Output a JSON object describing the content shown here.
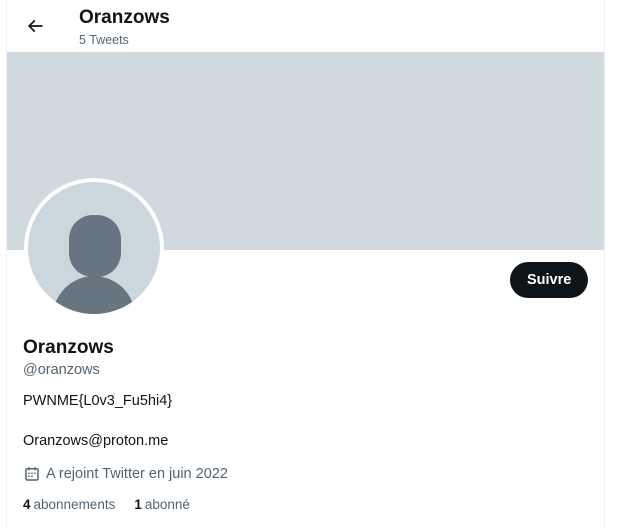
{
  "header": {
    "title": "Oranzows",
    "tweet_count": "5 Tweets",
    "back_icon": "arrow-left-icon"
  },
  "profile": {
    "banner_color": "#cfd9de",
    "avatar_icon": "default-avatar-icon",
    "follow_label": "Suivre",
    "name": "Oranzows",
    "handle": "@oranzows",
    "bio": "PWNME{L0v3_Fu5hi4}",
    "email": "Oranzows@proton.me",
    "joined_icon": "calendar-icon",
    "joined": "A rejoint Twitter en juin 2022",
    "following_count": "4",
    "following_label": "abonnements",
    "followers_count": "1",
    "followers_label": "abonné"
  },
  "colors": {
    "text_primary": "#0f1419",
    "text_secondary": "#536471",
    "follow_button_bg": "#0f1419",
    "avatar_placeholder_bg": "#ccd6dd",
    "avatar_silhouette": "#66757f"
  }
}
